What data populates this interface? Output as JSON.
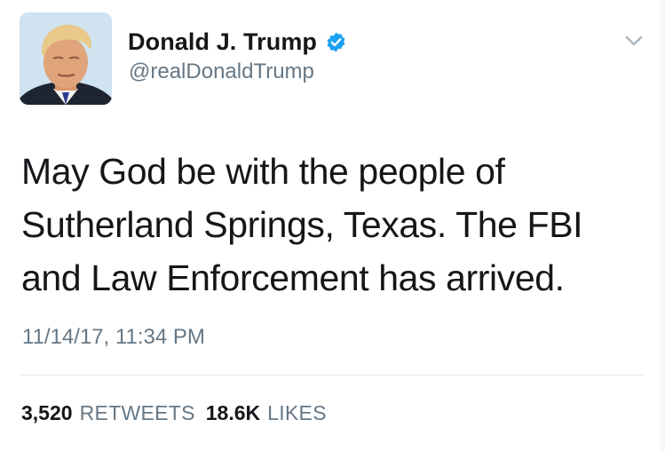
{
  "author": {
    "display_name": "Donald J. Trump",
    "handle": "@realDonaldTrump",
    "verified": true,
    "avatar_icon": "profile-photo"
  },
  "menu": {
    "icon": "chevron-down-icon"
  },
  "tweet": {
    "text": "May God be with the people of Sutherland Springs, Texas. The FBI and Law Enforcement has arrived.",
    "timestamp": "11/14/17, 11:34 PM"
  },
  "stats": {
    "retweets_count": "3,520",
    "retweets_label": "RETWEETS",
    "likes_count": "18.6K",
    "likes_label": "LIKES"
  },
  "colors": {
    "verified_blue": "#1da1f2",
    "secondary_text": "#657786",
    "primary_text": "#14171a",
    "divider": "#e1e8ed"
  }
}
